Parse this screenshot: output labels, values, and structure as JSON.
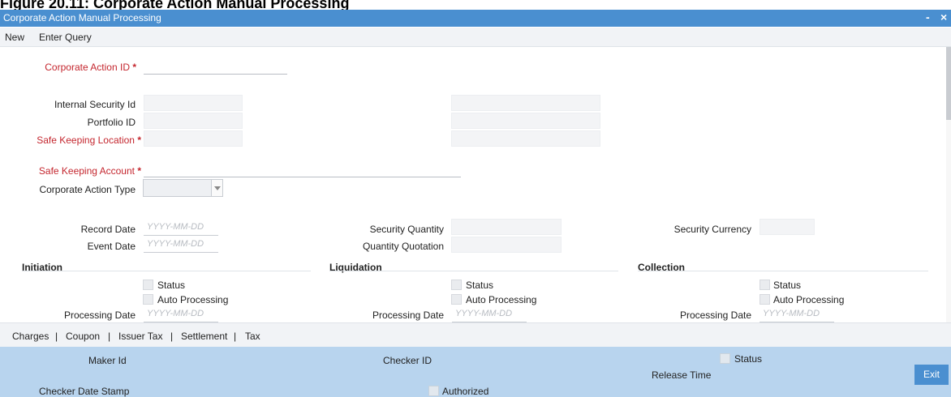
{
  "caption": "Figure 20.11: Corporate Action Manual Processing",
  "window": {
    "title": "Corporate Action Manual Processing",
    "minimize": "-",
    "close": "×"
  },
  "menu": {
    "new": "New",
    "enter_query": "Enter Query"
  },
  "form": {
    "corporate_action_id": "Corporate Action ID",
    "internal_security_id": "Internal Security Id",
    "portfolio_id": "Portfolio ID",
    "safe_keeping_location": "Safe Keeping Location",
    "safe_keeping_account": "Safe Keeping Account",
    "corporate_action_type": "Corporate Action Type",
    "record_date": "Record Date",
    "event_date": "Event Date",
    "date_placeholder": "YYYY-MM-DD",
    "security_quantity": "Security Quantity",
    "quantity_quotation": "Quantity Quotation",
    "security_currency": "Security Currency",
    "required_mark": "*"
  },
  "sections": {
    "initiation": "Initiation",
    "liquidation": "Liquidation",
    "collection": "Collection",
    "status": "Status",
    "auto_processing": "Auto Processing",
    "processing_date": "Processing Date"
  },
  "subtabs": {
    "charges": "Charges",
    "coupon": "Coupon",
    "issuer_tax": "Issuer Tax",
    "settlement": "Settlement",
    "tax": "Tax",
    "separator": "|"
  },
  "footer": {
    "maker_id": "Maker Id",
    "checker_id": "Checker ID",
    "status": "Status",
    "release_time": "Release Time",
    "checker_date_stamp": "Checker Date Stamp",
    "authorized": "Authorized",
    "exit": "Exit"
  }
}
